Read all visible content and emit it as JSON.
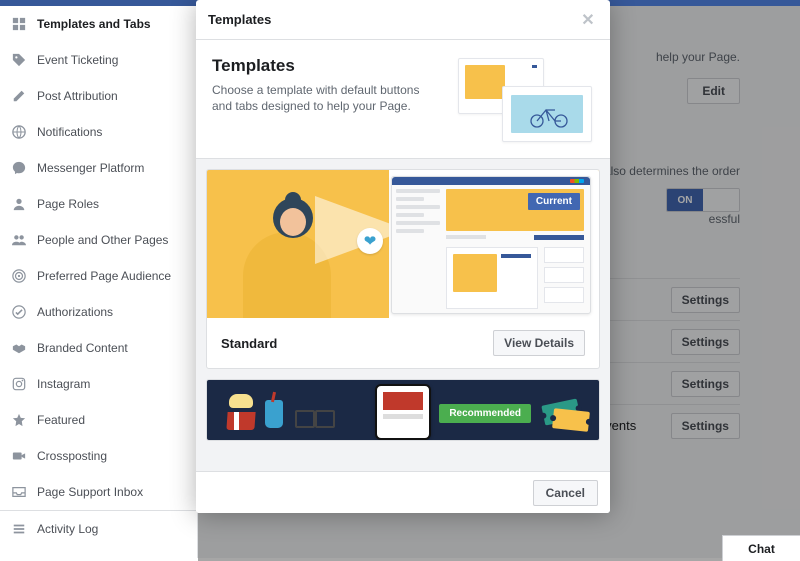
{
  "sidebar": {
    "items": [
      {
        "label": "Templates and Tabs",
        "icon": "grid",
        "selected": true
      },
      {
        "label": "Event Ticketing",
        "icon": "tag"
      },
      {
        "label": "Post Attribution",
        "icon": "pencil"
      },
      {
        "label": "Notifications",
        "icon": "globe"
      },
      {
        "label": "Messenger Platform",
        "icon": "messenger"
      },
      {
        "label": "Page Roles",
        "icon": "person"
      },
      {
        "label": "People and Other Pages",
        "icon": "people"
      },
      {
        "label": "Preferred Page Audience",
        "icon": "target"
      },
      {
        "label": "Authorizations",
        "icon": "check"
      },
      {
        "label": "Branded Content",
        "icon": "handshake"
      },
      {
        "label": "Instagram",
        "icon": "instagram"
      },
      {
        "label": "Featured",
        "icon": "star"
      },
      {
        "label": "Crossposting",
        "icon": "video"
      },
      {
        "label": "Page Support Inbox",
        "icon": "inbox"
      },
      {
        "label": "Activity Log",
        "icon": "list",
        "divider": true
      }
    ]
  },
  "background": {
    "help_text": "help your Page.",
    "edit_button": "Edit",
    "order_text": "also determines the order",
    "toggle_on": "ON",
    "success_hint": "essful",
    "settings_button": "Settings",
    "events_row": "Events"
  },
  "modal": {
    "title": "Templates",
    "intro_heading": "Templates",
    "intro_body": "Choose a template with default buttons and tabs designed to help your Page.",
    "current_badge": "Current",
    "template_name": "Standard",
    "view_details": "View Details",
    "recommended_badge": "Recommended",
    "cancel": "Cancel"
  },
  "chat": {
    "label": "Chat"
  }
}
